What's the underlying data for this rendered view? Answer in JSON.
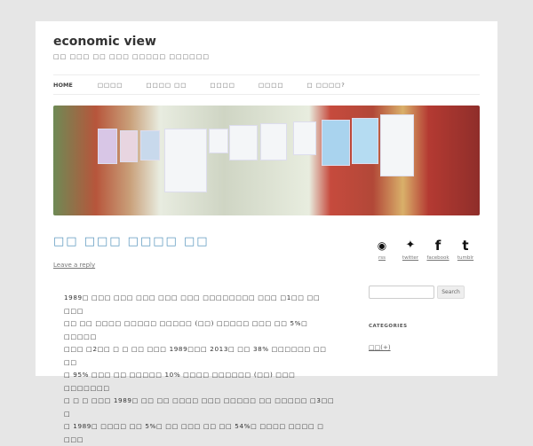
{
  "site": {
    "title": "economic view",
    "tagline": "□□ □□□ □□ □□□ □□□□□ □□□□□□"
  },
  "nav": [
    "HOME",
    "□□□□",
    "□□□□ □□",
    "□□□□",
    "□□□□",
    "□ □□□□?"
  ],
  "post": {
    "title": "□□ □□□ □□□□ □□",
    "reply": "Leave a reply",
    "lines": [
      "1989□ □□□ □□□ □□□ □□□ □□□ □□□□□□□□ □□□ □1□□ □□ □□□",
      "□□ □□ □□□□ □□□□□ □□□□□ (□□) □□□□□ □□□ □□ 5%□ □□□□□",
      "□□□ □2□□ □ □ □□ □□□ 1989□□□ 2013□ □□ 38% □□□□□□ □□ □□",
      "□ 95% □□□ □□ □□□□□ 10% □□□□ □□□□□□ (□□) □□□ □□□□□□□",
      "□ □ □ □□□ 1989□ □□ □□ □□□□ □□□ □□□□□ □□ □□□□□ □3□□ □",
      "□ 1989□ □□□□ □□ 5%□ □□ □□□ □□ □□ 54%□ □□□□ □□□□ □ □□□"
    ]
  },
  "sidebar": {
    "social": [
      {
        "icon": "rss-icon",
        "glyph": "◉",
        "label": "rss"
      },
      {
        "icon": "twitter-icon",
        "glyph": "🐦",
        "label": "twitter"
      },
      {
        "icon": "facebook-icon",
        "glyph": "f",
        "label": "facebook"
      },
      {
        "icon": "tumblr-icon",
        "glyph": "t",
        "label": "tumblr"
      }
    ],
    "search_button": "Search",
    "categories_heading": "CATEGORIES",
    "categories": [
      "□□(+)"
    ]
  }
}
